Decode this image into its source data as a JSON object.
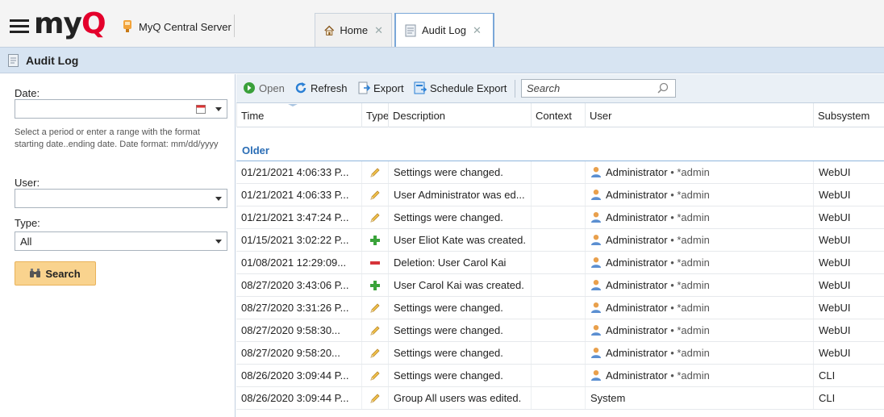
{
  "app": {
    "logo_text": "myQ",
    "server_name": "MyQ Central Server"
  },
  "tabs": [
    {
      "label": "Home",
      "icon": "home-icon",
      "active": false
    },
    {
      "label": "Audit Log",
      "icon": "document-icon",
      "active": true
    }
  ],
  "page": {
    "title": "Audit Log"
  },
  "filters": {
    "date_label": "Date:",
    "date_value": "",
    "date_hint": "Select a period or enter a range with the format starting date..ending date. Date format: mm/dd/yyyy",
    "user_label": "User:",
    "user_value": "",
    "type_label": "Type:",
    "type_value": "All",
    "search_button": "Search"
  },
  "toolbar": {
    "open": "Open",
    "refresh": "Refresh",
    "export": "Export",
    "schedule_export": "Schedule Export",
    "search_placeholder": "Search"
  },
  "grid": {
    "columns": [
      "Time",
      "Type",
      "Description",
      "Context",
      "User",
      "Subsystem"
    ],
    "group_label": "Older",
    "rows": [
      {
        "time": "01/21/2021 4:06:33 P...",
        "type": "edit",
        "description": "Settings were changed.",
        "context": "",
        "user": "Administrator",
        "login": " • *admin",
        "subsystem": "WebUI"
      },
      {
        "time": "01/21/2021 4:06:33 P...",
        "type": "edit",
        "description": "User Administrator was ed...",
        "context": "",
        "user": "Administrator",
        "login": " • *admin",
        "subsystem": "WebUI"
      },
      {
        "time": "01/21/2021 3:47:24 P...",
        "type": "edit",
        "description": "Settings were changed.",
        "context": "",
        "user": "Administrator",
        "login": " • *admin",
        "subsystem": "WebUI"
      },
      {
        "time": "01/15/2021 3:02:22 P...",
        "type": "create",
        "description": "User Eliot Kate was created.",
        "context": "",
        "user": "Administrator",
        "login": " • *admin",
        "subsystem": "WebUI"
      },
      {
        "time": "01/08/2021 12:29:09...",
        "type": "delete",
        "description": "Deletion: User Carol Kai",
        "context": "",
        "user": "Administrator",
        "login": " • *admin",
        "subsystem": "WebUI"
      },
      {
        "time": "08/27/2020 3:43:06 P...",
        "type": "create",
        "description": "User Carol Kai was created.",
        "context": "",
        "user": "Administrator",
        "login": " • *admin",
        "subsystem": "WebUI"
      },
      {
        "time": "08/27/2020 3:31:26 P...",
        "type": "edit",
        "description": "Settings were changed.",
        "context": "",
        "user": "Administrator",
        "login": " • *admin",
        "subsystem": "WebUI"
      },
      {
        "time": "08/27/2020 9:58:30...",
        "type": "edit",
        "description": "Settings were changed.",
        "context": "",
        "user": "Administrator",
        "login": " • *admin",
        "subsystem": "WebUI"
      },
      {
        "time": "08/27/2020 9:58:20...",
        "type": "edit",
        "description": "Settings were changed.",
        "context": "",
        "user": "Administrator",
        "login": " • *admin",
        "subsystem": "WebUI"
      },
      {
        "time": "08/26/2020 3:09:44 P...",
        "type": "edit",
        "description": "Settings were changed.",
        "context": "",
        "user": "Administrator",
        "login": " • *admin",
        "subsystem": "CLI"
      },
      {
        "time": "08/26/2020 3:09:44 P...",
        "type": "edit",
        "description": "Group All users was edited.",
        "context": "",
        "user": "System",
        "login": "",
        "subsystem": "CLI"
      }
    ]
  },
  "colors": {
    "title_bar": "#d7e4f2",
    "toolbar": "#eaf0f6",
    "search_button": "#f9d38e",
    "group_label": "#2a6db5",
    "logo_accent": "#e4002b"
  }
}
